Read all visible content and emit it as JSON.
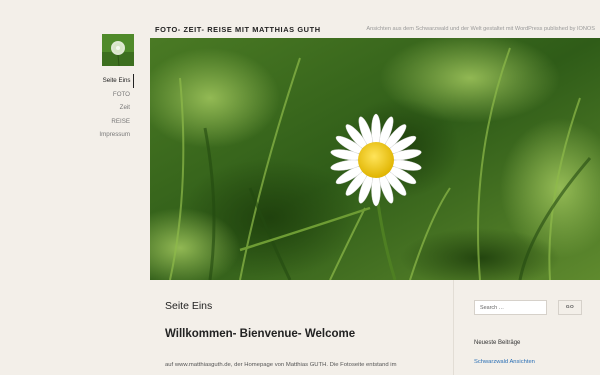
{
  "site": {
    "title": "FOTO- ZEIT- REISE MIT MATTHIAS GUTH",
    "tagline": "Ansichten aus dem Schwarzwald und der Welt gestaltet mit WordPress published by IONOS"
  },
  "nav": {
    "items": [
      {
        "label": "Seite Eins",
        "active": true
      },
      {
        "label": "FOTO",
        "active": false
      },
      {
        "label": "Zeit",
        "active": false
      },
      {
        "label": "REISE",
        "active": false
      },
      {
        "label": "Impressum",
        "active": false
      }
    ]
  },
  "content": {
    "page_title": "Seite Eins",
    "heading": "Willkommen- Bienvenue- Welcome",
    "intro": "auf www.matthiasguth.de, der Homepage von Matthias GUTH. Die Fotoseite entstand im"
  },
  "sidebar": {
    "search": {
      "placeholder": "Search …",
      "button_label": "GO"
    },
    "recent": {
      "title": "Neueste Beiträge",
      "items": [
        "Schwarzwald Ansichten"
      ]
    }
  },
  "colors": {
    "background": "#f3efe9",
    "link": "#2a6fb5",
    "text": "#222222"
  }
}
